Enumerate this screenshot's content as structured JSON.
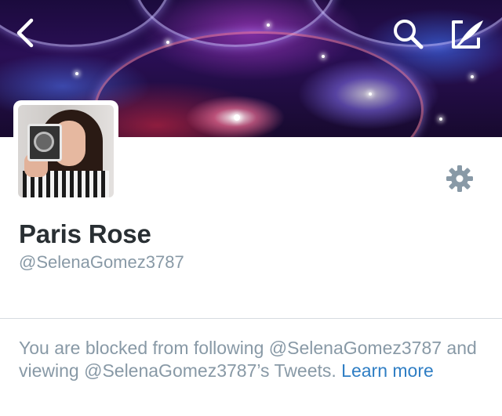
{
  "header": {
    "back_icon": "chevron-left-icon",
    "search_icon": "search-icon",
    "compose_icon": "compose-tweet-icon"
  },
  "profile": {
    "name": "Paris Rose",
    "handle": "@SelenaGomez3787",
    "settings_icon": "gear-icon"
  },
  "blocked_notice": {
    "message": "You are blocked from following @SelenaGomez3787 and viewing @SelenaGomez3787’s Tweets.",
    "link_label": "Learn more"
  },
  "colors": {
    "link": "#2f7ec4",
    "muted_text": "#8899a6",
    "name_text": "#292f33"
  }
}
